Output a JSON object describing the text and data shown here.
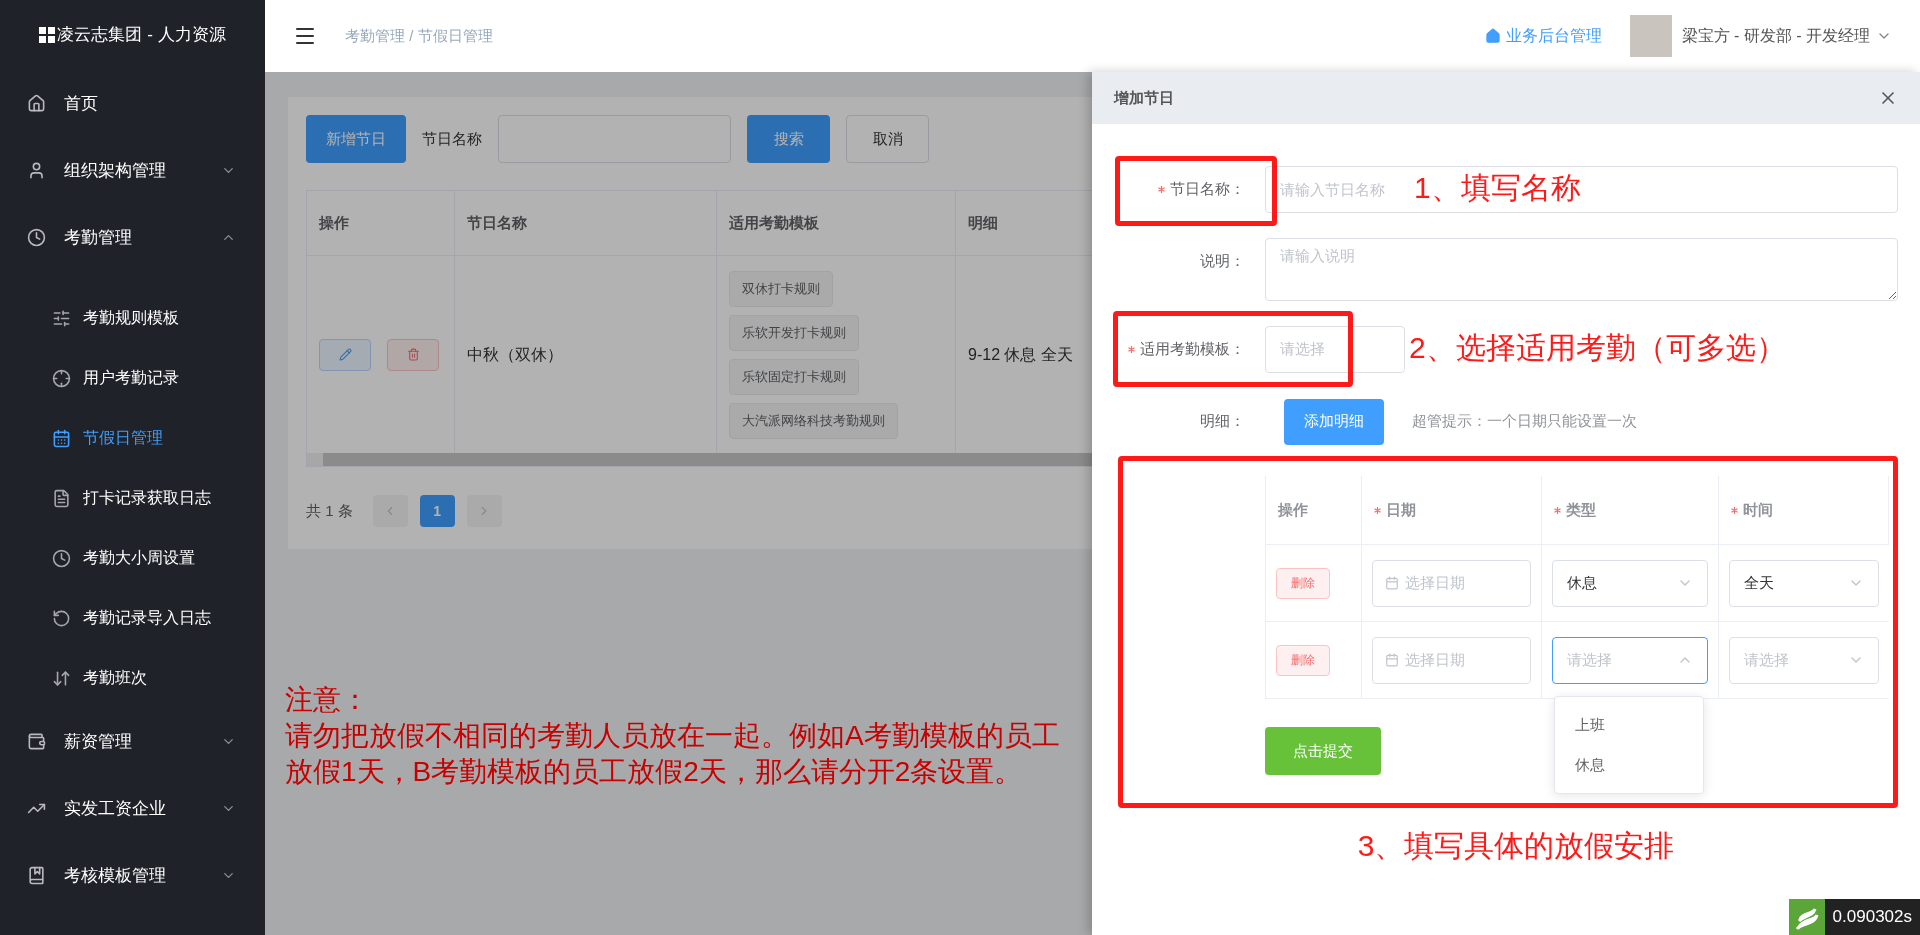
{
  "sidebar": {
    "logo": "凌云志集团 - 人力资源",
    "items": [
      {
        "label": "首页",
        "kind": "link"
      },
      {
        "label": "组织架构管理",
        "kind": "group",
        "expanded": false
      },
      {
        "label": "考勤管理",
        "kind": "group",
        "expanded": true,
        "children": [
          {
            "label": "考勤规则模板",
            "selected": false
          },
          {
            "label": "用户考勤记录",
            "selected": false
          },
          {
            "label": "节假日管理",
            "selected": true
          },
          {
            "label": "打卡记录获取日志",
            "selected": false
          },
          {
            "label": "考勤大小周设置",
            "selected": false
          },
          {
            "label": "考勤记录导入日志",
            "selected": false
          },
          {
            "label": "考勤班次",
            "selected": false
          }
        ]
      },
      {
        "label": "薪资管理",
        "kind": "group",
        "expanded": false
      },
      {
        "label": "实发工资企业",
        "kind": "group",
        "expanded": false
      },
      {
        "label": "考核模板管理",
        "kind": "group",
        "expanded": false
      }
    ]
  },
  "header": {
    "breadcrumb": "考勤管理 / 节假日管理",
    "link": "业务后台管理",
    "user": "梁宝方 - 研发部 - 开发经理"
  },
  "toolbar": {
    "add_button": "新增节日",
    "search_label": "节日名称",
    "search_button": "搜索",
    "cancel_button": "取消"
  },
  "table": {
    "columns": [
      "操作",
      "节日名称",
      "适用考勤模板",
      "明细"
    ],
    "rows": [
      {
        "name": "中秋（双休）",
        "templates": [
          "双休打卡规则",
          "乐软开发打卡规则",
          "乐软固定打卡规则",
          "大汽派网络科技考勤规则"
        ],
        "detail": "9-12 休息 全天"
      }
    ]
  },
  "pagination": {
    "total": "共 1 条",
    "pages": [
      {
        "label": "1",
        "selected": true
      }
    ]
  },
  "drawer": {
    "title": "增加节日",
    "fields": [
      {
        "kind": "input",
        "label": "节日名称：",
        "required": true,
        "placeholder": "请输入节日名称"
      },
      {
        "kind": "textarea",
        "label": "说明：",
        "required": false,
        "placeholder": "请输入说明"
      },
      {
        "kind": "select",
        "label": "适用考勤模板：",
        "required": true,
        "placeholder": "请选择"
      },
      {
        "kind": "button",
        "label": "明细：",
        "required": false,
        "button": "添加明细",
        "hint": "超管提示：一个日期只能设置一次"
      }
    ],
    "detail_table": {
      "columns": [
        {
          "label": "操作",
          "required": false
        },
        {
          "label": "日期",
          "required": true
        },
        {
          "label": "类型",
          "required": true
        },
        {
          "label": "时间",
          "required": true
        }
      ],
      "rows": [
        {
          "delete": "删除",
          "date_placeholder": "选择日期",
          "type": {
            "value": "休息",
            "open": false
          },
          "time": {
            "value": "全天"
          }
        },
        {
          "delete": "删除",
          "date_placeholder": "选择日期",
          "type": {
            "placeholder": "请选择",
            "open": true
          },
          "time": {
            "placeholder": "请选择"
          }
        }
      ],
      "dropdown_options": [
        "上班",
        "休息"
      ]
    },
    "submit": "点击提交"
  },
  "annotations": {
    "steps": [
      "1、填写名称",
      "2、选择适用考勤（可多选）",
      "3、填写具体的放假安排"
    ],
    "note_title": "注意：",
    "note": "请勿把放假不相同的考勤人员放在一起。例如A考勤模板的员工放假1天，B考勤模板的员工放假2天，那么请分开2条设置。"
  },
  "timer": "0.090302s"
}
